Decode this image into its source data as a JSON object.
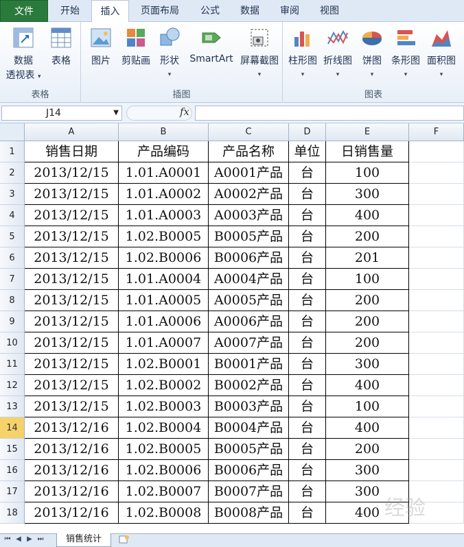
{
  "ribbon_tabs": [
    "文件",
    "开始",
    "插入",
    "页面布局",
    "公式",
    "数据",
    "审阅",
    "视图"
  ],
  "active_tab": "插入",
  "groups": {
    "tables": {
      "label": "表格",
      "pivot_line1": "数据",
      "pivot_line2": "透视表",
      "table": "表格"
    },
    "illustrations": {
      "label": "插图",
      "picture": "图片",
      "clipart": "剪贴画",
      "shapes": "形状",
      "smartart": "SmartArt",
      "screenshot": "屏幕截图"
    },
    "charts": {
      "label": "图表",
      "column": "柱形图",
      "line": "折线图",
      "pie": "饼图",
      "bar": "条形图",
      "area": "面积图"
    }
  },
  "formula_bar": {
    "name_box": "J14",
    "fx": "fx",
    "formula": ""
  },
  "columns": [
    "A",
    "B",
    "C",
    "D",
    "E",
    "F"
  ],
  "selected_row": "14",
  "rows": [
    {
      "n": "1",
      "a": "销售日期",
      "b": "产品编码",
      "c": "产品名称",
      "d": "单位",
      "e": "日销售量"
    },
    {
      "n": "2",
      "a": "2013/12/15",
      "b": "1.01.A0001",
      "c": "A0001产品",
      "d": "台",
      "e": "100"
    },
    {
      "n": "3",
      "a": "2013/12/15",
      "b": "1.01.A0002",
      "c": "A0002产品",
      "d": "台",
      "e": "300"
    },
    {
      "n": "4",
      "a": "2013/12/15",
      "b": "1.01.A0003",
      "c": "A0003产品",
      "d": "台",
      "e": "400"
    },
    {
      "n": "5",
      "a": "2013/12/15",
      "b": "1.02.B0005",
      "c": "B0005产品",
      "d": "台",
      "e": "200"
    },
    {
      "n": "6",
      "a": "2013/12/15",
      "b": "1.02.B0006",
      "c": "B0006产品",
      "d": "台",
      "e": "201"
    },
    {
      "n": "7",
      "a": "2013/12/15",
      "b": "1.01.A0004",
      "c": "A0004产品",
      "d": "台",
      "e": "100"
    },
    {
      "n": "8",
      "a": "2013/12/15",
      "b": "1.01.A0005",
      "c": "A0005产品",
      "d": "台",
      "e": "200"
    },
    {
      "n": "9",
      "a": "2013/12/15",
      "b": "1.01.A0006",
      "c": "A0006产品",
      "d": "台",
      "e": "200"
    },
    {
      "n": "10",
      "a": "2013/12/15",
      "b": "1.01.A0007",
      "c": "A0007产品",
      "d": "台",
      "e": "200"
    },
    {
      "n": "11",
      "a": "2013/12/15",
      "b": "1.02.B0001",
      "c": "B0001产品",
      "d": "台",
      "e": "300"
    },
    {
      "n": "12",
      "a": "2013/12/15",
      "b": "1.02.B0002",
      "c": "B0002产品",
      "d": "台",
      "e": "400"
    },
    {
      "n": "13",
      "a": "2013/12/15",
      "b": "1.02.B0003",
      "c": "B0003产品",
      "d": "台",
      "e": "100"
    },
    {
      "n": "14",
      "a": "2013/12/16",
      "b": "1.02.B0004",
      "c": "B0004产品",
      "d": "台",
      "e": "400"
    },
    {
      "n": "15",
      "a": "2013/12/16",
      "b": "1.02.B0005",
      "c": "B0005产品",
      "d": "台",
      "e": "200"
    },
    {
      "n": "16",
      "a": "2013/12/16",
      "b": "1.02.B0006",
      "c": "B0006产品",
      "d": "台",
      "e": "300"
    },
    {
      "n": "17",
      "a": "2013/12/16",
      "b": "1.02.B0007",
      "c": "B0007产品",
      "d": "台",
      "e": "300"
    },
    {
      "n": "18",
      "a": "2013/12/16",
      "b": "1.02.B0008",
      "c": "B0008产品",
      "d": "台",
      "e": "400"
    }
  ],
  "sheet_tab": "销售统计",
  "watermark": "经验"
}
